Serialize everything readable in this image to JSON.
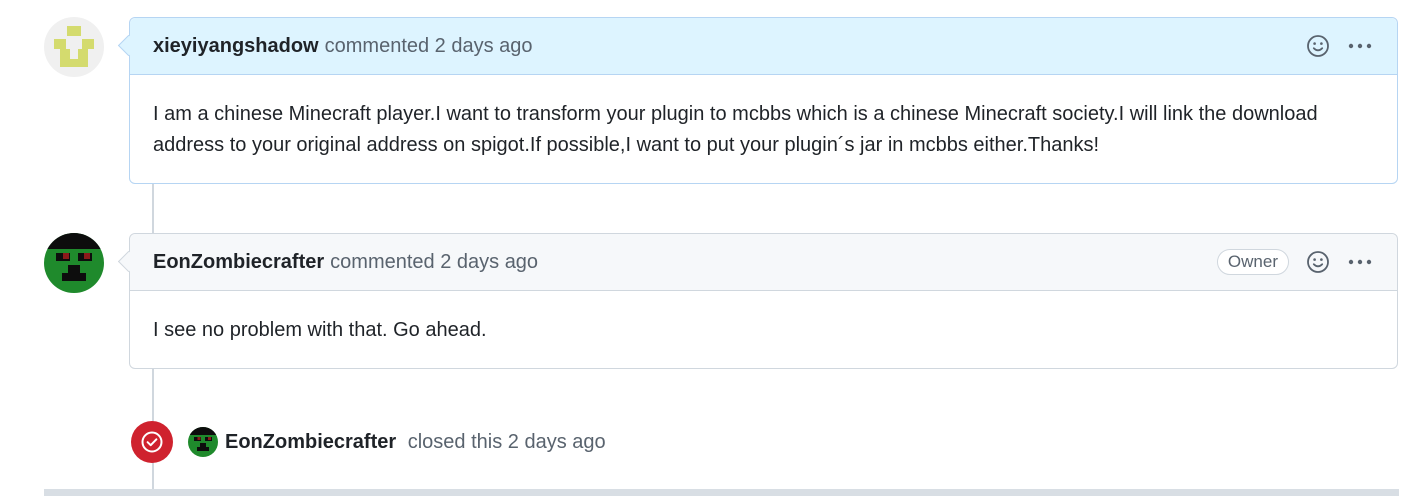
{
  "comments": [
    {
      "author": "xieyiyangshadow",
      "meta": "commented 2 days ago",
      "body": "I am a chinese Minecraft player.I want to transform your plugin to mcbbs which is a chinese Minecraft society.I will link the download address to your original address on spigot.If possible,I want to put your plugin´s jar in mcbbs either.Thanks!",
      "avatar_icon": "identicon-avatar",
      "avatar_colors": {
        "background": "#f0f0f0",
        "pattern": "#d4db6e"
      },
      "header_color": "#ddf4ff"
    },
    {
      "author": "EonZombiecrafter",
      "meta": "commented 2 days ago",
      "badge": "Owner",
      "body": "I see no problem with that. Go ahead.",
      "avatar_icon": "zombie-avatar",
      "avatar_colors": {
        "background": "#1f8a2c",
        "dark": "#0d0d0d",
        "eyes": "#8b1a1a"
      },
      "header_color": "#f6f8fa"
    }
  ],
  "event": {
    "author": "EonZombiecrafter",
    "meta": "closed this 2 days ago",
    "icon": "issue-closed-icon",
    "badge_color": "#cf222e"
  },
  "icons": {
    "reaction": "smiley-icon",
    "more": "kebab-horizontal-icon"
  }
}
